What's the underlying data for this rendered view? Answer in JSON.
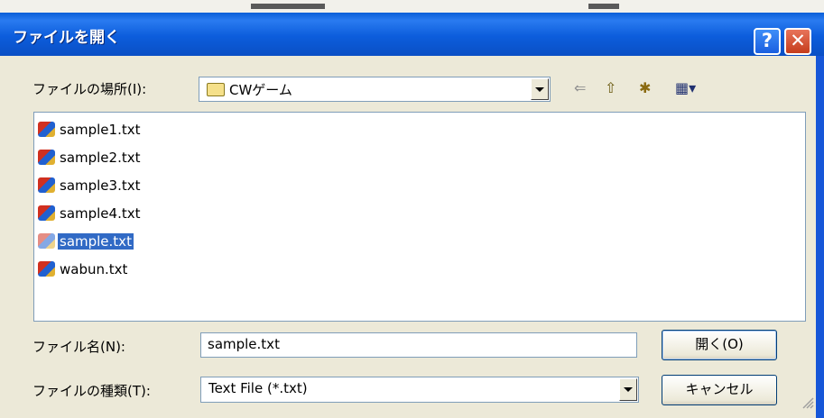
{
  "window": {
    "title": "ファイルを開く",
    "help_glyph": "?",
    "close_glyph": "✕"
  },
  "look_in": {
    "label": "ファイルの場所(I):",
    "value": "CWゲーム"
  },
  "toolbar": {
    "back_glyph": "⇐",
    "up_glyph": "⇧",
    "new_folder_glyph": "✱",
    "view_glyph": "▦▾"
  },
  "files": [
    {
      "name": "sample1.txt",
      "selected": false
    },
    {
      "name": "sample2.txt",
      "selected": false
    },
    {
      "name": "sample3.txt",
      "selected": false
    },
    {
      "name": "sample4.txt",
      "selected": false
    },
    {
      "name": "sample.txt",
      "selected": true
    },
    {
      "name": "wabun.txt",
      "selected": false
    }
  ],
  "filename": {
    "label": "ファイル名(N):",
    "value": "sample.txt"
  },
  "filetype": {
    "label": "ファイルの種類(T):",
    "value": "Text File (*.txt)"
  },
  "buttons": {
    "open": "開く(O)",
    "cancel": "キャンセル"
  },
  "colors": {
    "titlebar": "#0a5fd8",
    "selection": "#316ac5",
    "dialog_bg": "#ece9d8"
  }
}
